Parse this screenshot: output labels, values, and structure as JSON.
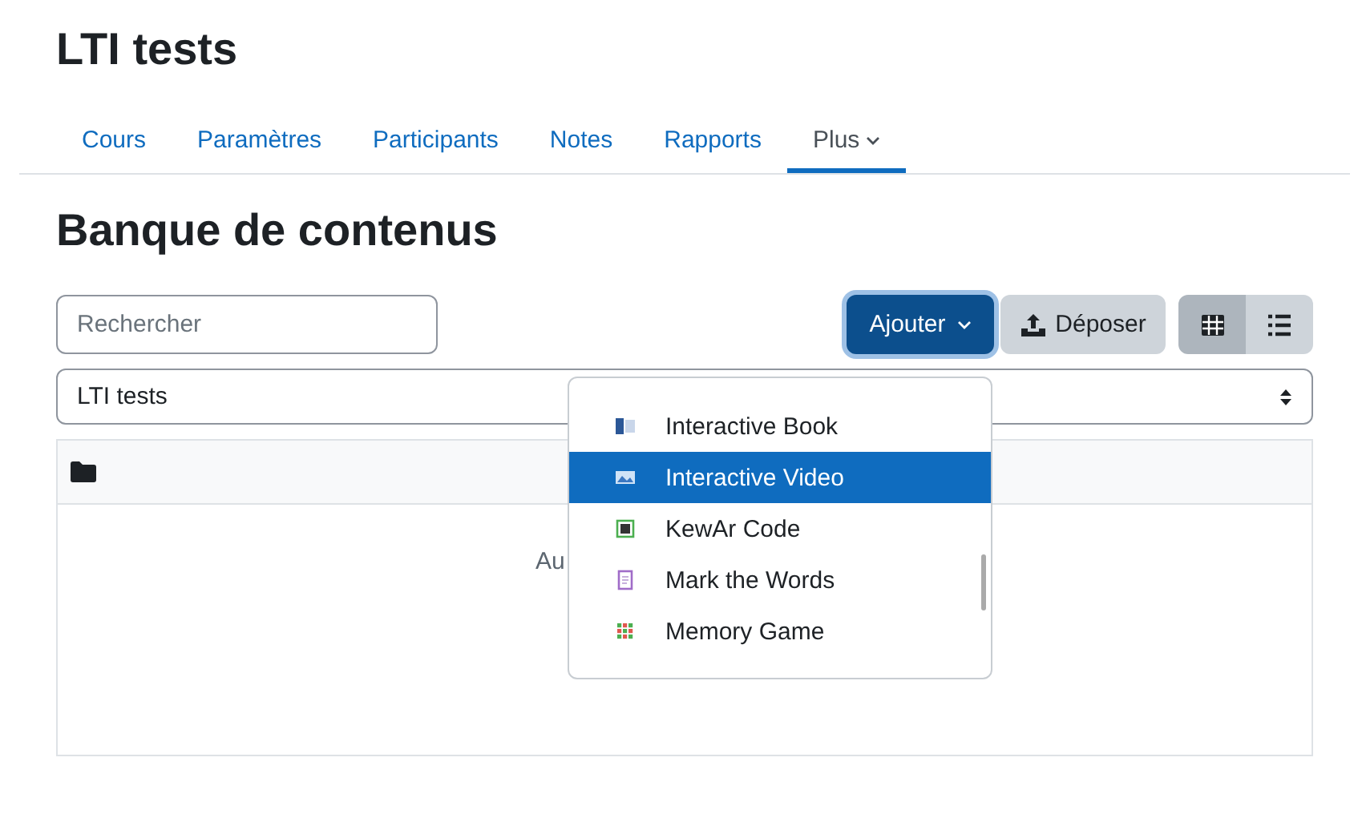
{
  "page_title": "LTI tests",
  "tabs": [
    {
      "label": "Cours",
      "selected": false
    },
    {
      "label": "Paramètres",
      "selected": false
    },
    {
      "label": "Participants",
      "selected": false
    },
    {
      "label": "Notes",
      "selected": false
    },
    {
      "label": "Rapports",
      "selected": false
    },
    {
      "label": "Plus",
      "selected": true,
      "kind": "dropdown"
    }
  ],
  "heading": "Banque de contenus",
  "search": {
    "placeholder": "Rechercher"
  },
  "add_button": {
    "label": "Ajouter",
    "expanded": true
  },
  "upload_button": {
    "label": "Déposer"
  },
  "view_toggle": [
    {
      "kind": "grid",
      "selected": true
    },
    {
      "kind": "list",
      "selected": false
    }
  ],
  "context_select": {
    "value": "LTI tests"
  },
  "empty_message": "Au",
  "add_menu": [
    {
      "label": "Interactive Book",
      "kind": "book",
      "selected": false
    },
    {
      "label": "Interactive Video",
      "kind": "video",
      "selected": true
    },
    {
      "label": "KewAr Code",
      "kind": "qr",
      "selected": false
    },
    {
      "label": "Mark the Words",
      "kind": "doc",
      "selected": false
    },
    {
      "label": "Memory Game",
      "kind": "grid",
      "selected": false
    }
  ]
}
